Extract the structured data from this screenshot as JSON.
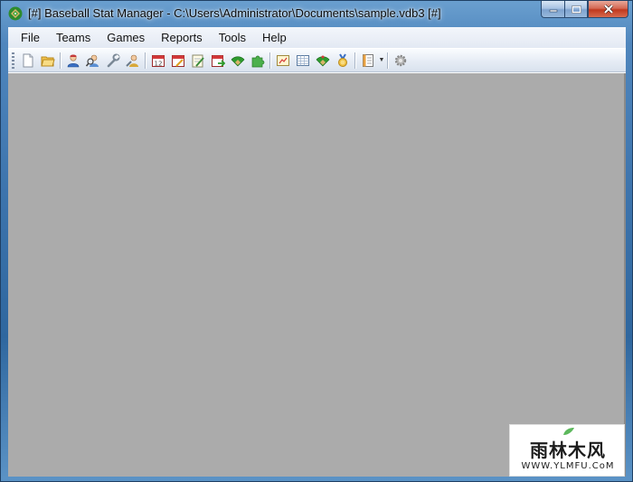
{
  "window": {
    "title": "[#] Baseball Stat Manager - C:\\Users\\Administrator\\Documents\\sample.vdb3 [#]"
  },
  "menu": [
    "File",
    "Teams",
    "Games",
    "Reports",
    "Tools",
    "Help"
  ],
  "toolbar": {
    "groups": [
      [
        "new-file-icon",
        "open-folder-icon"
      ],
      [
        "player-icon",
        "player-search-icon",
        "wrench-icon",
        "team-edit-icon"
      ],
      [
        "calendar-icon",
        "calendar-edit-icon",
        "notepad-edit-icon",
        "calendar-export-icon",
        "field-icon",
        "puzzle-icon"
      ],
      [
        "report-icon",
        "spreadsheet-icon",
        "field-stats-icon",
        "medal-icon"
      ],
      [
        "layout-icon"
      ],
      [
        "settings-gear-icon"
      ]
    ]
  },
  "watermark": {
    "main": "雨林木风",
    "sub": "WWW.YLMFU.CoM"
  },
  "colors": {
    "mdi_background": "#ababab",
    "title_gradient": "#4f86bd"
  }
}
